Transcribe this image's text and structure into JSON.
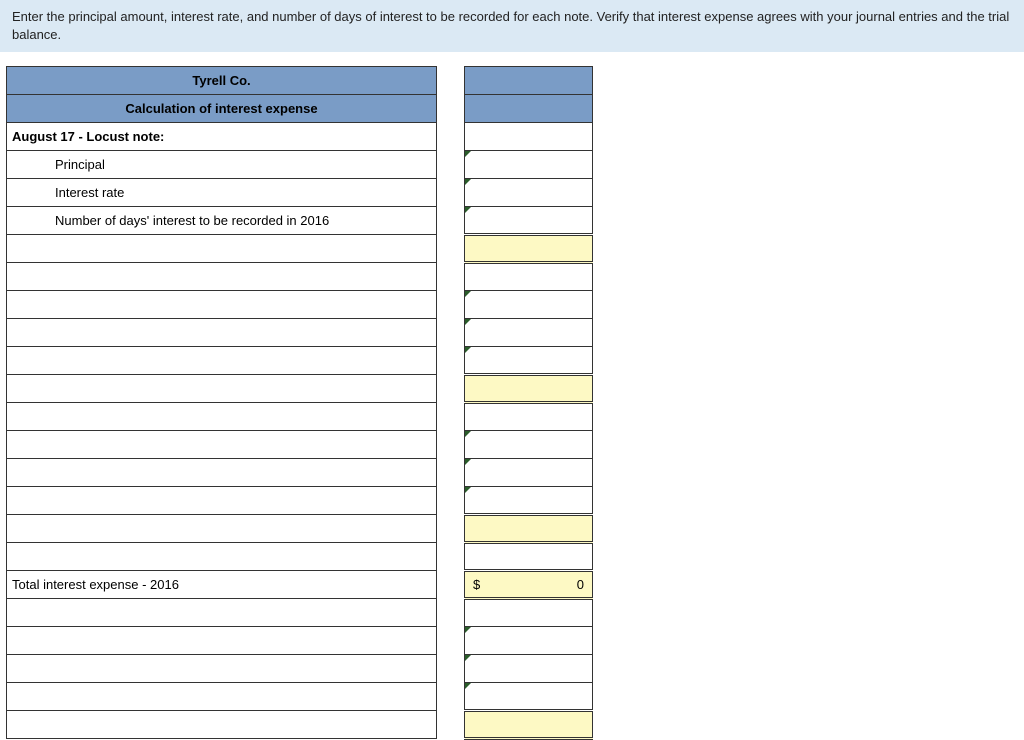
{
  "instructions": "Enter the principal amount, interest rate, and number of days of interest to be recorded for each note. Verify that interest expense agrees with your journal entries and the trial balance.",
  "company": "Tyrell Co.",
  "title": "Calculation of interest expense",
  "section_header": "August 17 - Locust note:",
  "labels": {
    "principal": "Principal",
    "rate": "Interest rate",
    "days": "Number of days' interest to be recorded in 2016",
    "total": "Total interest expense - 2016"
  },
  "total": {
    "currency": "$",
    "value": "0"
  }
}
